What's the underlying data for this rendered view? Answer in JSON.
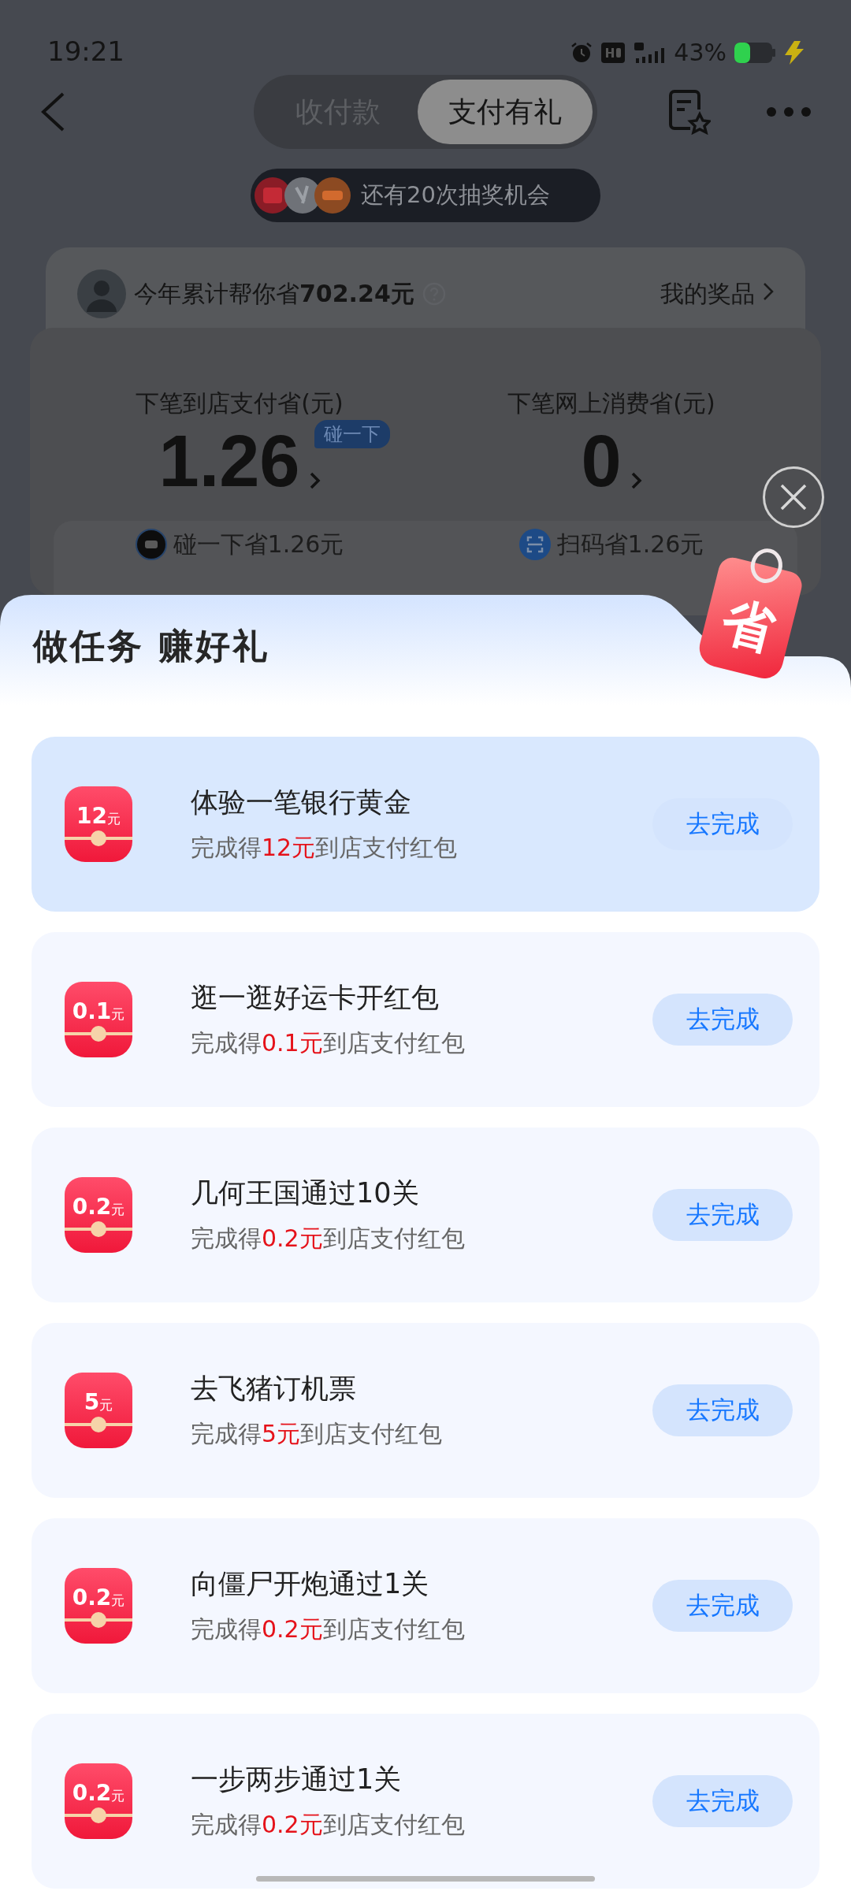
{
  "status_bar": {
    "time": "19:21",
    "battery": "43%"
  },
  "nav": {
    "tabs": [
      {
        "label": "收付款",
        "selected": false
      },
      {
        "label": "支付有礼",
        "selected": true
      }
    ]
  },
  "lottery": {
    "text": "还有20次抽奖机会"
  },
  "summary": {
    "text": "今年累计帮你省**702.24元**",
    "link": "我的奖品"
  },
  "stats": [
    {
      "label": "下笔到店支付省(元)",
      "value": "1.26",
      "tag": "碰一下"
    },
    {
      "label": "下笔网上消费省(元)",
      "value": "0"
    }
  ],
  "methods": [
    {
      "kind": "tap",
      "text": "碰一下省1.26元"
    },
    {
      "kind": "scan",
      "text": "扫码省1.26元"
    }
  ],
  "sheet": {
    "title": "做任务 赚好礼",
    "tag": "省",
    "tasks": [
      {
        "amount": "12",
        "unit": "元",
        "title": "体验一笔银行黄金",
        "reward": {
          "before": "完成得",
          "amount": "12元",
          "after": "到店支付红包"
        },
        "button": "去完成",
        "highlighted": true
      },
      {
        "amount": "0.1",
        "unit": "元",
        "title": "逛一逛好运卡开红包",
        "reward": {
          "before": "完成得",
          "amount": "0.1元",
          "after": "到店支付红包"
        },
        "button": "去完成",
        "highlighted": false
      },
      {
        "amount": "0.2",
        "unit": "元",
        "title": "几何王国通过10关",
        "reward": {
          "before": "完成得",
          "amount": "0.2元",
          "after": "到店支付红包"
        },
        "button": "去完成",
        "highlighted": false
      },
      {
        "amount": "5",
        "unit": "元",
        "title": "去飞猪订机票",
        "reward": {
          "before": "完成得",
          "amount": "5元",
          "after": "到店支付红包"
        },
        "button": "去完成",
        "highlighted": false
      },
      {
        "amount": "0.2",
        "unit": "元",
        "title": "向僵尸开炮通过1关",
        "reward": {
          "before": "完成得",
          "amount": "0.2元",
          "after": "到店支付红包"
        },
        "button": "去完成",
        "highlighted": false
      },
      {
        "amount": "0.2",
        "unit": "元",
        "title": "一步两步通过1关",
        "reward": {
          "before": "完成得",
          "amount": "0.2元",
          "after": "到店支付红包"
        },
        "button": "去完成",
        "highlighted": false
      }
    ]
  }
}
